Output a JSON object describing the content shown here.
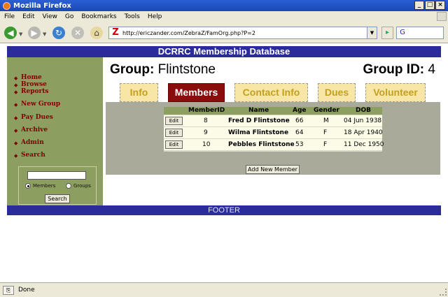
{
  "window": {
    "title": "Mozilla Firefox"
  },
  "menu": [
    "File",
    "Edit",
    "View",
    "Go",
    "Bookmarks",
    "Tools",
    "Help"
  ],
  "address": {
    "url": "http://ericzander.com/ZebraZ/FamOrg.php?P=2"
  },
  "page": {
    "header": "DCRRC Membership Database",
    "sidebar": {
      "links": [
        "Home",
        "Browse",
        "Reports",
        "New Group",
        "Pay Dues",
        "Archive",
        "Admin",
        "Search"
      ],
      "search": {
        "radio_members": "Members",
        "radio_groups": "Groups",
        "selected": "Members",
        "button": "Search"
      }
    },
    "group": {
      "label": "Group:",
      "name": "Flintstone",
      "id_label": "Group ID:",
      "id": "4"
    },
    "tabs": [
      "Info",
      "Members",
      "Contact Info",
      "Dues",
      "Volunteer"
    ],
    "active_tab": "Members",
    "members_table": {
      "columns": [
        "MemberID",
        "Name",
        "Age",
        "Gender",
        "DOB"
      ],
      "edit_label": "Edit",
      "rows": [
        {
          "id": "8",
          "name": "Fred D Flintstone",
          "age": "66",
          "gender": "M",
          "dob": "04 Jun 1938"
        },
        {
          "id": "9",
          "name": "Wilma Flintstone",
          "age": "64",
          "gender": "F",
          "dob": "18 Apr 1940"
        },
        {
          "id": "10",
          "name": "Pebbles Flintstone",
          "age": "53",
          "gender": "F",
          "dob": "11 Dec 1950"
        }
      ]
    },
    "add_button": "Add New Member",
    "footer": "FOOTER"
  },
  "status": {
    "text": "Done"
  },
  "colors": {
    "header_bg": "#2b2b9a",
    "sidebar_bg": "#8c9e60",
    "active_tab_bg": "#8a0c0c",
    "tab_bg": "#f7e6a6",
    "link_color": "#800000"
  }
}
